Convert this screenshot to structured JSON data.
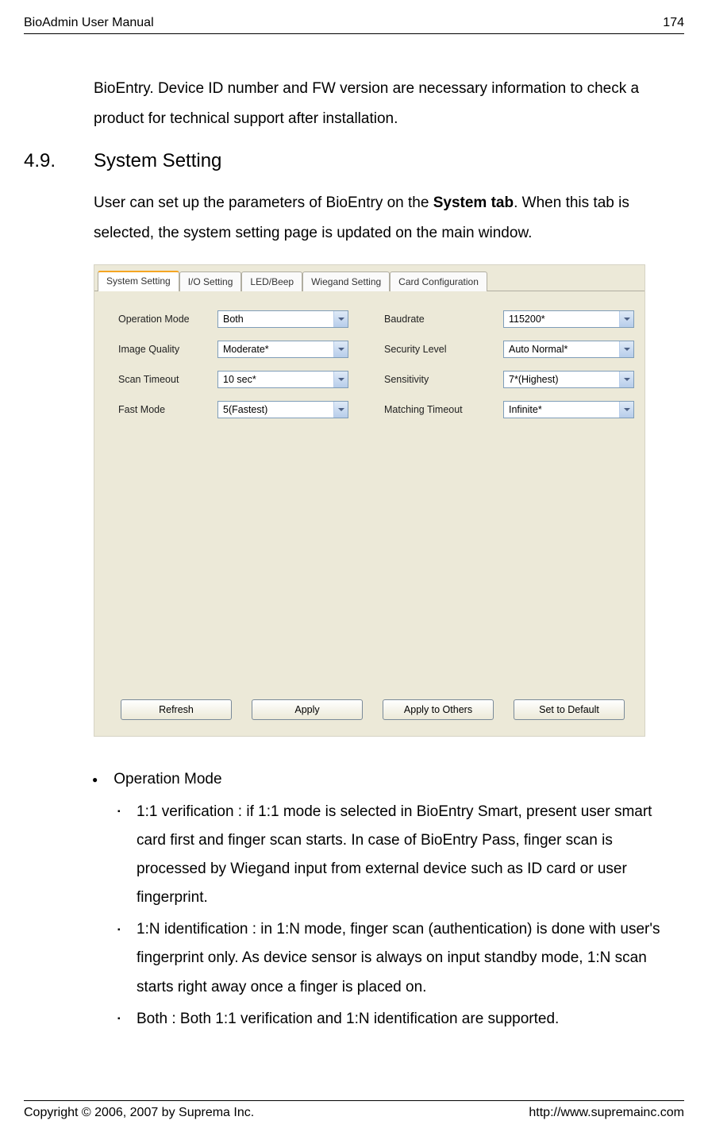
{
  "header": {
    "left": "BioAdmin User Manual",
    "right": "174"
  },
  "intro": "BioEntry. Device ID number and FW version are necessary information to check a product for technical support after installation.",
  "section": {
    "number": "4.9.",
    "title": "System Setting",
    "para_before": "User can set up the parameters of BioEntry on the ",
    "para_bold": "System tab",
    "para_after": ". When this tab is selected, the system setting page is updated on the main window."
  },
  "screenshot": {
    "tabs": [
      "System Setting",
      "I/O Setting",
      "LED/Beep",
      "Wiegand Setting",
      "Card Configuration"
    ],
    "active_tab": 0,
    "fields": {
      "left": [
        {
          "label": "Operation Mode",
          "value": "Both"
        },
        {
          "label": "Image Quality",
          "value": "Moderate*"
        },
        {
          "label": "Scan Timeout",
          "value": "10 sec*"
        },
        {
          "label": "Fast Mode",
          "value": "5(Fastest)"
        }
      ],
      "right": [
        {
          "label": "Baudrate",
          "value": "115200*"
        },
        {
          "label": "Security Level",
          "value": "Auto Normal*"
        },
        {
          "label": "Sensitivity",
          "value": "7*(Highest)"
        },
        {
          "label": "Matching Timeout",
          "value": "Infinite*"
        }
      ]
    },
    "buttons": [
      "Refresh",
      "Apply",
      "Apply to Others",
      "Set to Default"
    ]
  },
  "bullets": {
    "l1": "Operation Mode",
    "l2": [
      "1:1 verification : if 1:1 mode is selected in BioEntry Smart, present user smart card first and finger scan starts. In case of BioEntry Pass, finger scan is processed by Wiegand input from external device such as ID card or user fingerprint.",
      "1:N identification : in 1:N mode, finger scan (authentication) is done with user's fingerprint only. As device sensor is always on input standby mode, 1:N scan starts right away once a finger is placed on.",
      "Both : Both 1:1 verification and 1:N identification are supported."
    ]
  },
  "footer": {
    "left": "Copyright © 2006, 2007 by Suprema Inc.",
    "right": "http://www.supremainc.com"
  }
}
